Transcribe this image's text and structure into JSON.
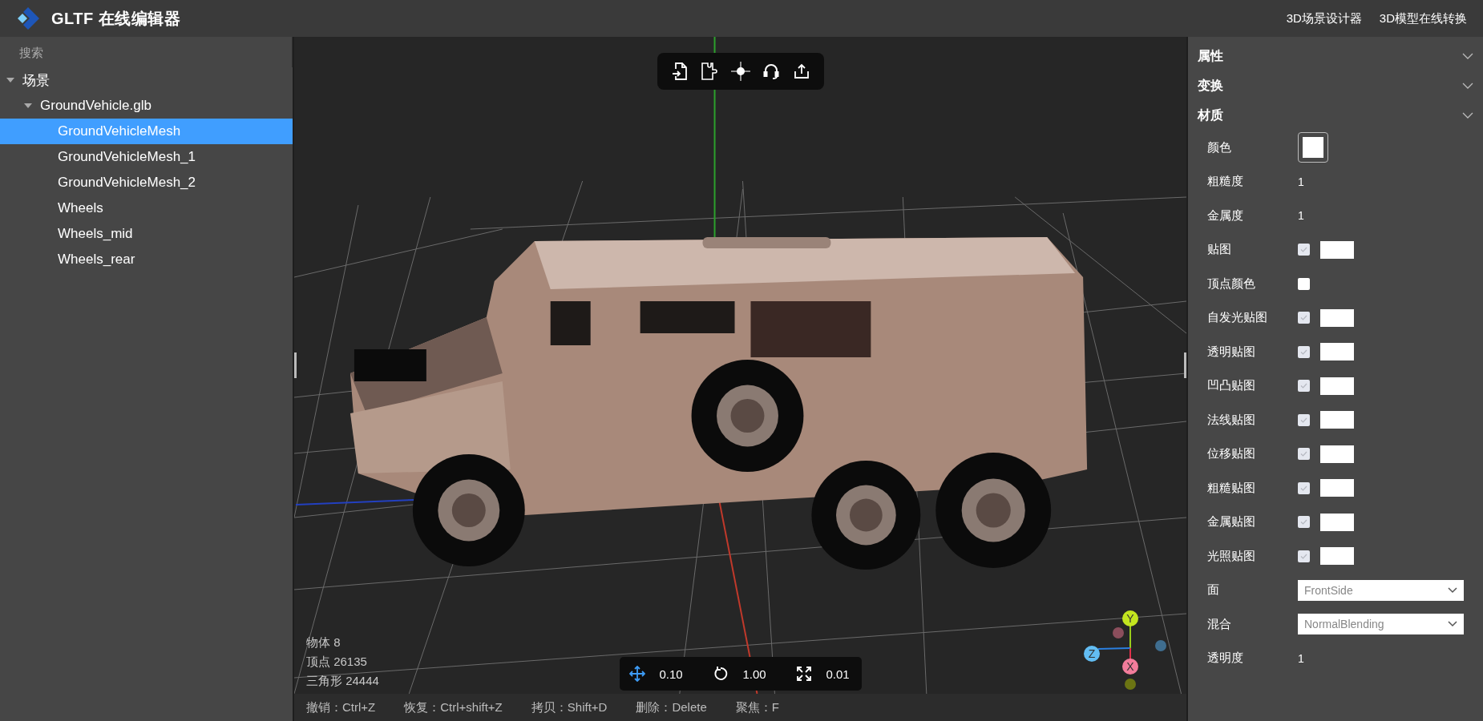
{
  "header": {
    "title": "GLTF 在线编辑器",
    "links": [
      "3D场景设计器",
      "3D模型在线转换"
    ]
  },
  "outliner": {
    "search": {
      "placeholder": "搜索"
    },
    "tree": [
      {
        "label": "场景",
        "expanded": true,
        "selected": false,
        "children": [
          {
            "label": "GroundVehicle.glb",
            "expanded": true,
            "selected": false,
            "children": [
              {
                "label": "GroundVehicleMesh",
                "selected": true
              },
              {
                "label": "GroundVehicleMesh_1",
                "selected": false
              },
              {
                "label": "GroundVehicleMesh_2",
                "selected": false
              },
              {
                "label": "Wheels",
                "selected": false
              },
              {
                "label": "Wheels_mid",
                "selected": false
              },
              {
                "label": "Wheels_rear",
                "selected": false
              }
            ]
          }
        ]
      }
    ]
  },
  "viewport": {
    "stats": [
      "物体 8",
      "顶点 26135",
      "三角形 24444"
    ],
    "transform": [
      {
        "kind": "move",
        "value": "0.10"
      },
      {
        "kind": "rotate",
        "value": "1.00"
      },
      {
        "kind": "scale",
        "value": "0.01"
      }
    ],
    "gizmo": [
      {
        "label": "Y",
        "color": "#c3e51f"
      },
      {
        "label": "Z",
        "color": "#62bdf3"
      },
      {
        "label": "X",
        "color": "#f27c9b"
      }
    ]
  },
  "status_bar": [
    "撤销：Ctrl+Z",
    "恢复：Ctrl+shift+Z",
    "拷贝：Shift+D",
    "删除：Delete",
    "聚焦：F"
  ],
  "inspector": {
    "sections": [
      {
        "title": "属性"
      },
      {
        "title": "变换"
      },
      {
        "title": "材质",
        "rows": [
          {
            "kind": "color",
            "label": "颜色",
            "color": "#ffffff"
          },
          {
            "kind": "number",
            "label": "粗糙度",
            "value": "1"
          },
          {
            "kind": "number",
            "label": "金属度",
            "value": "1"
          },
          {
            "kind": "map",
            "label": "贴图",
            "checked": true
          },
          {
            "kind": "checkbox",
            "label": "顶点颜色",
            "checked": false
          },
          {
            "kind": "map",
            "label": "自发光贴图",
            "checked": true
          },
          {
            "kind": "map",
            "label": "透明贴图",
            "checked": true
          },
          {
            "kind": "map",
            "label": "凹凸贴图",
            "checked": true
          },
          {
            "kind": "map",
            "label": "法线贴图",
            "checked": true
          },
          {
            "kind": "map",
            "label": "位移贴图",
            "checked": true
          },
          {
            "kind": "map",
            "label": "粗糙贴图",
            "checked": true
          },
          {
            "kind": "map",
            "label": "金属贴图",
            "checked": true
          },
          {
            "kind": "map",
            "label": "光照贴图",
            "checked": true
          },
          {
            "kind": "select",
            "label": "面",
            "value": "FrontSide"
          },
          {
            "kind": "select",
            "label": "混合",
            "value": "NormalBlending"
          },
          {
            "kind": "number",
            "label": "透明度",
            "value": "1"
          }
        ]
      }
    ]
  }
}
